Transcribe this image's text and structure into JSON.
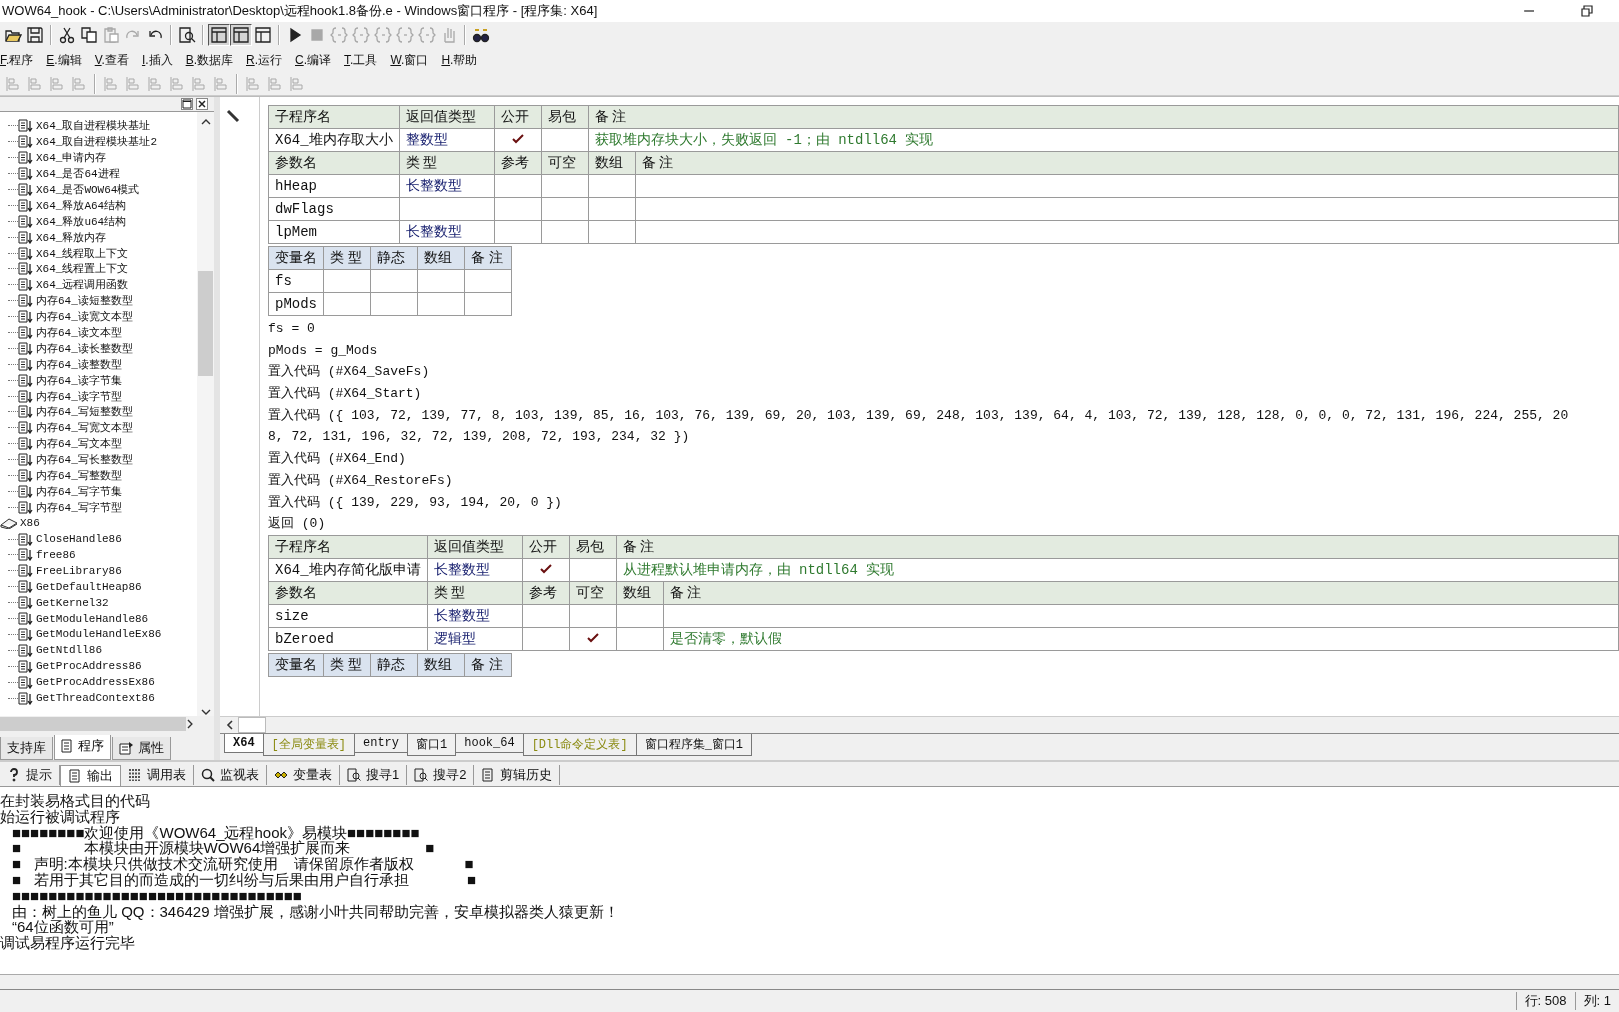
{
  "window": {
    "title": "WOW64_hook - C:\\Users\\Administrator\\Desktop\\远程hook1.8备份.e - Windows窗口程序 - [程序集: X64]"
  },
  "toolbar": [
    {
      "kind": "open",
      "disabled": false
    },
    {
      "kind": "save",
      "disabled": false
    },
    {
      "kind": "separator"
    },
    {
      "kind": "cut",
      "disabled": false
    },
    {
      "kind": "copy",
      "disabled": false
    },
    {
      "kind": "paste",
      "disabled": true
    },
    {
      "kind": "redo",
      "disabled": true
    },
    {
      "kind": "undo",
      "disabled": false
    },
    {
      "kind": "separator"
    },
    {
      "kind": "find",
      "disabled": false
    },
    {
      "kind": "separator"
    },
    {
      "kind": "layout",
      "disabled": false,
      "selected": true
    },
    {
      "kind": "layout",
      "disabled": false,
      "selected": true
    },
    {
      "kind": "layout",
      "disabled": false,
      "selected": false
    },
    {
      "kind": "separator"
    },
    {
      "kind": "run",
      "disabled": false
    },
    {
      "kind": "stop",
      "disabled": true
    },
    {
      "kind": "step",
      "disabled": true
    },
    {
      "kind": "step",
      "disabled": true
    },
    {
      "kind": "step",
      "disabled": true
    },
    {
      "kind": "step",
      "disabled": true
    },
    {
      "kind": "step",
      "disabled": true
    },
    {
      "kind": "hand",
      "disabled": true
    },
    {
      "kind": "separator"
    },
    {
      "kind": "binoculars",
      "disabled": false
    }
  ],
  "menu": [
    "F.程序",
    "E.编辑",
    "V.查看",
    "I.插入",
    "B.数据库",
    "R.运行",
    "C.编译",
    "T.工具",
    "W.窗口",
    "H.帮助"
  ],
  "align_toolbar": [
    {
      "kind": "align"
    },
    {
      "kind": "align"
    },
    {
      "kind": "align"
    },
    {
      "kind": "align"
    },
    {
      "kind": "separator"
    },
    {
      "kind": "align"
    },
    {
      "kind": "align"
    },
    {
      "kind": "align"
    },
    {
      "kind": "align"
    },
    {
      "kind": "align"
    },
    {
      "kind": "align"
    },
    {
      "kind": "separator"
    },
    {
      "kind": "align"
    },
    {
      "kind": "align"
    },
    {
      "kind": "align"
    }
  ],
  "tree": [
    {
      "children": [
        {
          "label": "X64_取自进程模块基址"
        },
        {
          "label": "X64_取自进程模块基址2"
        },
        {
          "label": "X64_申请内存"
        },
        {
          "label": "X64_是否64进程"
        },
        {
          "label": "X64_是否WOW64模式"
        },
        {
          "label": "X64_释放A64结构"
        },
        {
          "label": "X64_释放u64结构"
        },
        {
          "label": "X64_释放内存"
        },
        {
          "label": "X64_线程取上下文"
        },
        {
          "label": "X64_线程置上下文"
        },
        {
          "label": "X64_远程调用函数"
        },
        {
          "label": "内存64_读短整数型"
        },
        {
          "label": "内存64_读宽文本型"
        },
        {
          "label": "内存64_读文本型"
        },
        {
          "label": "内存64_读长整数型"
        },
        {
          "label": "内存64_读整数型"
        },
        {
          "label": "内存64_读字节集"
        },
        {
          "label": "内存64_读字节型"
        },
        {
          "label": "内存64_写短整数型"
        },
        {
          "label": "内存64_写宽文本型"
        },
        {
          "label": "内存64_写文本型"
        },
        {
          "label": "内存64_写长整数型"
        },
        {
          "label": "内存64_写整数型"
        },
        {
          "label": "内存64_写字节集"
        },
        {
          "label": "内存64_写字节型"
        }
      ]
    },
    {
      "label": "X86",
      "children": [
        {
          "label": "CloseHandle86"
        },
        {
          "label": "free86"
        },
        {
          "label": "FreeLibrary86"
        },
        {
          "label": "GetDefaultHeap86"
        },
        {
          "label": "GetKernel32"
        },
        {
          "label": "GetModuleHandle86"
        },
        {
          "label": "GetModuleHandleEx86"
        },
        {
          "label": "GetNtdll86"
        },
        {
          "label": "GetProcAddress86"
        },
        {
          "label": "GetProcAddressEx86"
        },
        {
          "label": "GetThreadContext86"
        }
      ]
    }
  ],
  "panel_tabs": [
    {
      "label": "支持库",
      "kind": "plain",
      "selected": false
    },
    {
      "label": "程序",
      "kind": "program",
      "selected": true
    },
    {
      "label": "属性",
      "kind": "properties",
      "selected": false
    }
  ],
  "editor": {
    "blocks": [
      {
        "kind": "sub",
        "header": [
          "子程序名",
          "返回值类型",
          "公开",
          "易包",
          "备 注"
        ],
        "name": "X64_堆内存取大小",
        "return_type": "整数型",
        "public": true,
        "easy_pack": false,
        "comment": "获取堆内存块大小，失败返回 -1；由 ntdll64 实现",
        "param_header": [
          "参数名",
          "类 型",
          "参考",
          "可空",
          "数组",
          "备 注"
        ],
        "params": [
          {
            "name": "hHeap",
            "type": "长整数型",
            "ref": false,
            "nullable": false,
            "array": false
          },
          {
            "name": "dwFlags",
            "ref": false,
            "nullable": false,
            "array": false
          },
          {
            "name": "lpMem",
            "type": "长整数型",
            "ref": false,
            "nullable": false,
            "array": false
          }
        ]
      },
      {
        "kind": "vars",
        "header": [
          "变量名",
          "类 型",
          "静态",
          "数组",
          "备 注"
        ],
        "rows": [
          {
            "name": "fs"
          },
          {
            "name": "pMods"
          }
        ]
      },
      {
        "kind": "code",
        "text": "fs = 0"
      },
      {
        "kind": "code",
        "text": "pMods = g_Mods"
      },
      {
        "kind": "code",
        "text": "置入代码 (#X64_SaveFs)"
      },
      {
        "kind": "code",
        "text": "置入代码 (#X64_Start)"
      },
      {
        "kind": "code",
        "text": "置入代码 ({ 103, 72, 139, 77, 8, 103, 139, 85, 16, 103, 76, 139, 69, 20, 103, 139, 69, 248, 103, 139, 64, 4, 103, 72, 139, 128, 128, 0, 0, 0, 72, 131, 196, 224, 255, 20"
      },
      {
        "kind": "code",
        "text": "8, 72, 131, 196, 32, 72, 139, 208, 72, 193, 234, 32 })"
      },
      {
        "kind": "code",
        "text": "置入代码 (#X64_End)"
      },
      {
        "kind": "code",
        "text": "置入代码 (#X64_RestoreFs)"
      },
      {
        "kind": "code",
        "text": "置入代码 ({ 139, 229, 93, 194, 20, 0 })"
      },
      {
        "kind": "code",
        "text": "返回 (0)"
      },
      {
        "kind": "sub",
        "header": [
          "子程序名",
          "返回值类型",
          "公开",
          "易包",
          "备 注"
        ],
        "name": "X64_堆内存简化版申请",
        "return_type": "长整数型",
        "public": true,
        "easy_pack": false,
        "comment": "从进程默认堆申请内存，由 ntdll64 实现",
        "param_header": [
          "参数名",
          "类 型",
          "参考",
          "可空",
          "数组",
          "备 注"
        ],
        "params": [
          {
            "name": "size",
            "type": "长整数型",
            "ref": false,
            "nullable": false,
            "array": false
          },
          {
            "name": "bZeroed",
            "type": "逻辑型",
            "ref": false,
            "nullable": true,
            "array": false,
            "comment": "是否清零，默认假"
          }
        ]
      },
      {
        "kind": "vars",
        "header": [
          "变量名",
          "类 型",
          "静态",
          "数组",
          "备 注"
        ]
      }
    ]
  },
  "editor_tabs": [
    {
      "label": "X64",
      "kind": "module",
      "selected": true
    },
    {
      "label": "[全局变量表]",
      "kind": "table",
      "selected": false
    },
    {
      "label": "entry",
      "kind": "module",
      "selected": false
    },
    {
      "label": "窗口1",
      "kind": "module",
      "selected": false
    },
    {
      "label": "hook_64",
      "kind": "module",
      "selected": false
    },
    {
      "label": "[Dll命令定义表]",
      "kind": "table",
      "selected": false
    },
    {
      "label": "窗口程序集_窗口1",
      "kind": "module",
      "selected": false
    }
  ],
  "output_tabs": [
    {
      "label": "提示",
      "kind": "hint",
      "selected": false
    },
    {
      "label": "输出",
      "kind": "output",
      "selected": true
    },
    {
      "label": "调用表",
      "kind": "calls",
      "selected": false
    },
    {
      "label": "监视表",
      "kind": "watch",
      "selected": false
    },
    {
      "label": "变量表",
      "kind": "vars",
      "selected": false
    },
    {
      "label": "搜寻1",
      "kind": "search",
      "selected": false
    },
    {
      "label": "搜寻2",
      "kind": "search",
      "selected": false
    },
    {
      "label": "剪辑历史",
      "kind": "history",
      "selected": false
    }
  ],
  "output": [
    {
      "kind": "plain",
      "text": "在封装易格式目的代码"
    },
    {
      "kind": "plain",
      "text": "始运行被调试程序"
    },
    {
      "kind": "box",
      "text": "■■■■■■■■欢迎使用《WOW64_远程hook》易模块■■■■■■■■"
    },
    {
      "kind": "box",
      "text": "■               本模块由开源模块WOW64增强扩展而来                  ■"
    },
    {
      "kind": "box",
      "text": "■   声明:本模块只供做技术交流研究使用    请保留原作者版权            ■"
    },
    {
      "kind": "box",
      "text": "■   若用于其它目的而造成的一切纠纷与后果由用户自行承担              ■"
    },
    {
      "kind": "box",
      "text": "■■■■■■■■■■■■■■■■■■■■■■■■■■■■■■■■"
    },
    {
      "kind": "box",
      "text": "由：树上的鱼儿 QQ：346429 增强扩展，感谢小叶共同帮助完善，安卓模拟器类人猿更新！"
    },
    {
      "kind": "box",
      "text": "“64位函数可用”"
    },
    {
      "kind": "plain",
      "text": "调试易程序运行完毕"
    }
  ],
  "status_bar": {
    "line": "行: 508",
    "column": "列: 1"
  }
}
